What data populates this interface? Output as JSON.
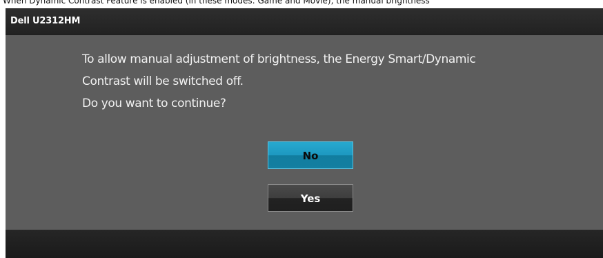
{
  "caption": "When Dynamic Contrast Feature is enabled (in these modes: Game and Movie), the manual brightness",
  "osd": {
    "title": "Dell U2312HM",
    "message_lines": [
      "To allow manual adjustment of brightness, the Energy Smart/Dynamic",
      "Contrast will be switched off.",
      "Do you want to continue?"
    ],
    "buttons": {
      "no_label": "No",
      "yes_label": "Yes"
    }
  },
  "colors": {
    "header_bg": "#262626",
    "body_bg": "#5d5d5d",
    "selected_button": "#1d98c0",
    "unselected_button": "#2f2f2f"
  }
}
